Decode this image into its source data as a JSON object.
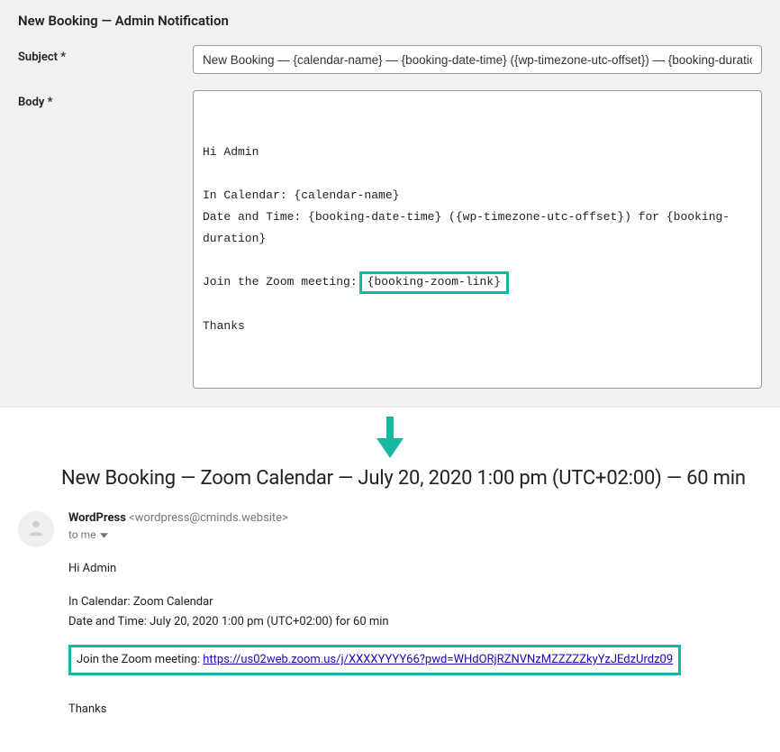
{
  "settings": {
    "title": "New Booking — Admin Notification",
    "subject_label": "Subject *",
    "body_label": "Body *",
    "subject_value": "New Booking — {calendar-name} — {booking-date-time} ({wp-timezone-utc-offset}) — {booking-duration}",
    "body": {
      "line1": "Hi Admin",
      "line2": "In Calendar: {calendar-name}",
      "line3": "Date and Time: {booking-date-time} ({wp-timezone-utc-offset}) for {booking-duration}",
      "line4_prefix": "Join the Zoom meeting:",
      "line4_highlight": "{booking-zoom-link}",
      "line5": "Thanks"
    }
  },
  "result": {
    "title": "New Booking — Zoom Calendar — July 20, 2020 1:00 pm (UTC+02:00) — 60 min",
    "sender_name": "WordPress",
    "sender_email": "<wordpress@cminds.website>",
    "to_line": "to me",
    "body": {
      "greeting": "Hi Admin",
      "calendar_line": "In Calendar: Zoom Calendar",
      "datetime_line": "Date and Time: July 20, 2020 1:00 pm (UTC+02:00) for 60 min",
      "zoom_prefix": "Join the Zoom meeting: ",
      "zoom_link": "https://us02web.zoom.us/j/XXXXYYYY66?pwd=WHdORjRZNVNzMZZZZZkyYzJEdzUrdz09",
      "closing": "Thanks"
    }
  },
  "colors": {
    "highlight_border": "#15b8a1",
    "link": "#1a0dab"
  }
}
